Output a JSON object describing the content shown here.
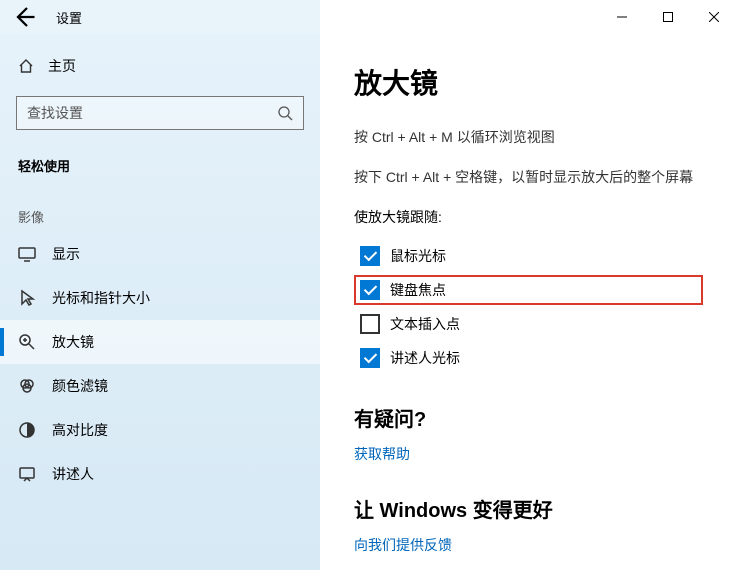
{
  "titlebar": {
    "title": "设置"
  },
  "sidebar": {
    "home": "主页",
    "search_placeholder": "查找设置",
    "category": "轻松使用",
    "group": "影像",
    "items": [
      {
        "label": "显示"
      },
      {
        "label": "光标和指针大小"
      },
      {
        "label": "放大镜"
      },
      {
        "label": "颜色滤镜"
      },
      {
        "label": "高对比度"
      },
      {
        "label": "讲述人"
      }
    ]
  },
  "content": {
    "heading": "放大镜",
    "hint1": "按 Ctrl + Alt + M 以循环浏览视图",
    "hint2": "按下 Ctrl + Alt + 空格键，以暂时显示放大后的整个屏幕",
    "follow_label": "使放大镜跟随:",
    "checks": [
      {
        "label": "鼠标光标",
        "checked": true,
        "highlight": false
      },
      {
        "label": "键盘焦点",
        "checked": true,
        "highlight": true
      },
      {
        "label": "文本插入点",
        "checked": false,
        "highlight": false
      },
      {
        "label": "讲述人光标",
        "checked": true,
        "highlight": false
      }
    ],
    "help_heading": "有疑问?",
    "help_link": "获取帮助",
    "improve_heading": "让 Windows 变得更好",
    "feedback_link": "向我们提供反馈"
  }
}
